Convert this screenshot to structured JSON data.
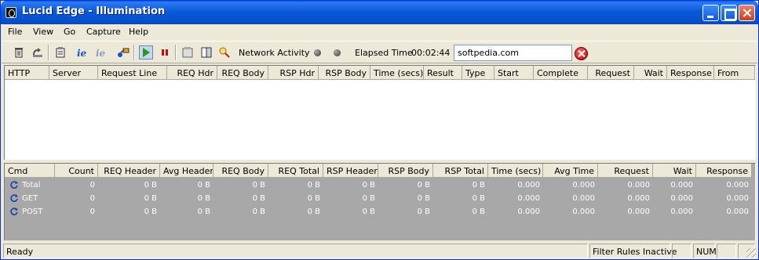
{
  "window": {
    "title": "Lucid Edge - Illumination"
  },
  "menu": [
    "File",
    "View",
    "Go",
    "Capture",
    "Help"
  ],
  "toolbar": {
    "network_activity_label": "Network Activity",
    "elapsed_label": "Elapsed Time",
    "elapsed_value": "00:02:44",
    "url_value": "softpedia.com"
  },
  "requests_table": {
    "columns": [
      "HTTP",
      "Server",
      "Request Line",
      "REQ Hdr",
      "REQ Body",
      "RSP Hdr",
      "RSP Body",
      "Time (secs)",
      "Result",
      "Type",
      "Start",
      "Complete",
      "Request",
      "Wait",
      "Response",
      "From"
    ]
  },
  "summary_table": {
    "columns": [
      "Cmd",
      "Count",
      "REQ Header",
      "Avg Header",
      "REQ Body",
      "REQ Total",
      "RSP Header",
      "RSP Body",
      "RSP Total",
      "Time (secs)",
      "Avg Time",
      "Request",
      "Wait",
      "Response"
    ],
    "rows": [
      {
        "cmd": "Total",
        "values": [
          "0",
          "0 B",
          "0 B",
          "0 B",
          "0 B",
          "0 B",
          "0 B",
          "0 B",
          "0.000",
          "0.000",
          "0.000",
          "0.000",
          "0.000"
        ]
      },
      {
        "cmd": "GET",
        "values": [
          "0",
          "0 B",
          "0 B",
          "0 B",
          "0 B",
          "0 B",
          "0 B",
          "0 B",
          "0.000",
          "0.000",
          "0.000",
          "0.000",
          "0.000"
        ]
      },
      {
        "cmd": "POST",
        "values": [
          "0",
          "0 B",
          "0 B",
          "0 B",
          "0 B",
          "0 B",
          "0 B",
          "0 B",
          "0.000",
          "0.000",
          "0.000",
          "0.000",
          "0.000"
        ]
      }
    ]
  },
  "status": {
    "left": "Ready",
    "filter": "Filter Rules Inactive",
    "num": "NUM"
  },
  "icons": [
    "trash-icon",
    "open-icon",
    "clipboard-icon",
    "ie-icon",
    "ie-disabled-icon",
    "connect-icon",
    "play-icon",
    "pause-icon",
    "options-icon",
    "book-icon",
    "magnifier-icon",
    "activity-led-icon",
    "stop-icon",
    "refresh-icon"
  ]
}
